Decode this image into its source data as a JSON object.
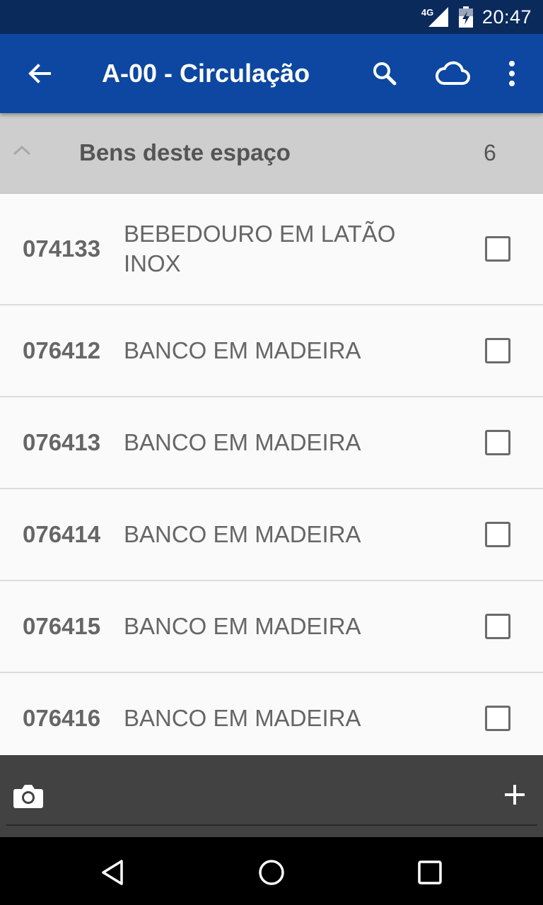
{
  "status_bar": {
    "network": "4G",
    "time": "20:47"
  },
  "app_bar": {
    "title": "A-00 - Circulação",
    "icons": [
      "back-arrow-icon",
      "search-icon",
      "cloud-icon",
      "more-vert-icon"
    ]
  },
  "section": {
    "title": "Bens deste espaço",
    "count": "6",
    "expanded": true
  },
  "items": [
    {
      "code": "074133",
      "description": "BEBEDOURO EM LATÃO INOX",
      "checked": false
    },
    {
      "code": "076412",
      "description": "BANCO EM MADEIRA",
      "checked": false
    },
    {
      "code": "076413",
      "description": "BANCO EM MADEIRA",
      "checked": false
    },
    {
      "code": "076414",
      "description": "BANCO EM MADEIRA",
      "checked": false
    },
    {
      "code": "076415",
      "description": "BANCO EM MADEIRA",
      "checked": false
    },
    {
      "code": "076416",
      "description": "BANCO EM MADEIRA",
      "checked": false
    }
  ],
  "bottom_bar": {
    "icons": [
      "camera-icon",
      "add-icon"
    ]
  },
  "nav_bar": {
    "icons": [
      "nav-back-icon",
      "nav-home-icon",
      "nav-recents-icon"
    ]
  },
  "colors": {
    "status_bar": "#0b2a5c",
    "app_bar": "#0d47a1",
    "section_header": "#cecece",
    "bottom_bar": "#424242",
    "text_gray": "#666666"
  }
}
